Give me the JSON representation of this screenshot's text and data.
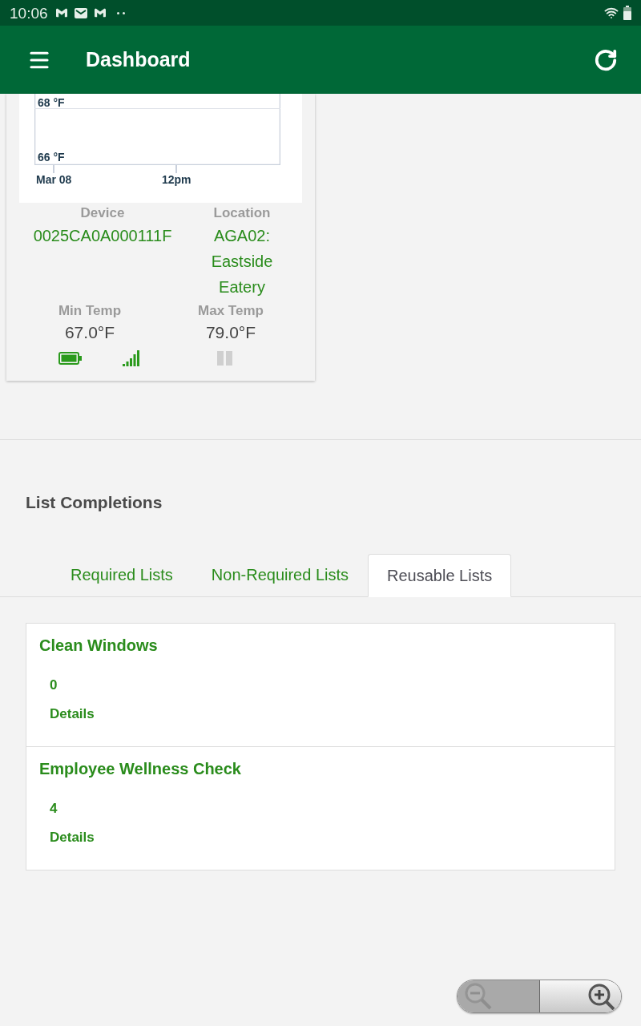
{
  "status_bar": {
    "time": "10:06"
  },
  "app_bar": {
    "title": "Dashboard"
  },
  "sensor_card": {
    "chart": {
      "y_labels": [
        "68 °F",
        "66 °F"
      ],
      "x_labels": [
        "Mar 08",
        "12pm"
      ]
    },
    "device": {
      "label": "Device",
      "value": "0025CA0A000111F"
    },
    "location": {
      "label": "Location",
      "value": "AGA02: Eastside Eatery"
    },
    "temps": [
      {
        "label": "Min Temp",
        "value": "67.0°F"
      },
      {
        "label": "Max Temp",
        "value": "79.0°F"
      }
    ]
  },
  "list_completions": {
    "title": "List Completions",
    "tabs": [
      {
        "label": "Required Lists",
        "selected": false
      },
      {
        "label": "Non-Required Lists",
        "selected": false
      },
      {
        "label": "Reusable Lists",
        "selected": true
      }
    ],
    "lists": [
      {
        "name": "Clean Windows",
        "count": "0",
        "link": "Details"
      },
      {
        "name": "Employee Wellness Check",
        "count": "4",
        "link": "Details"
      }
    ]
  }
}
